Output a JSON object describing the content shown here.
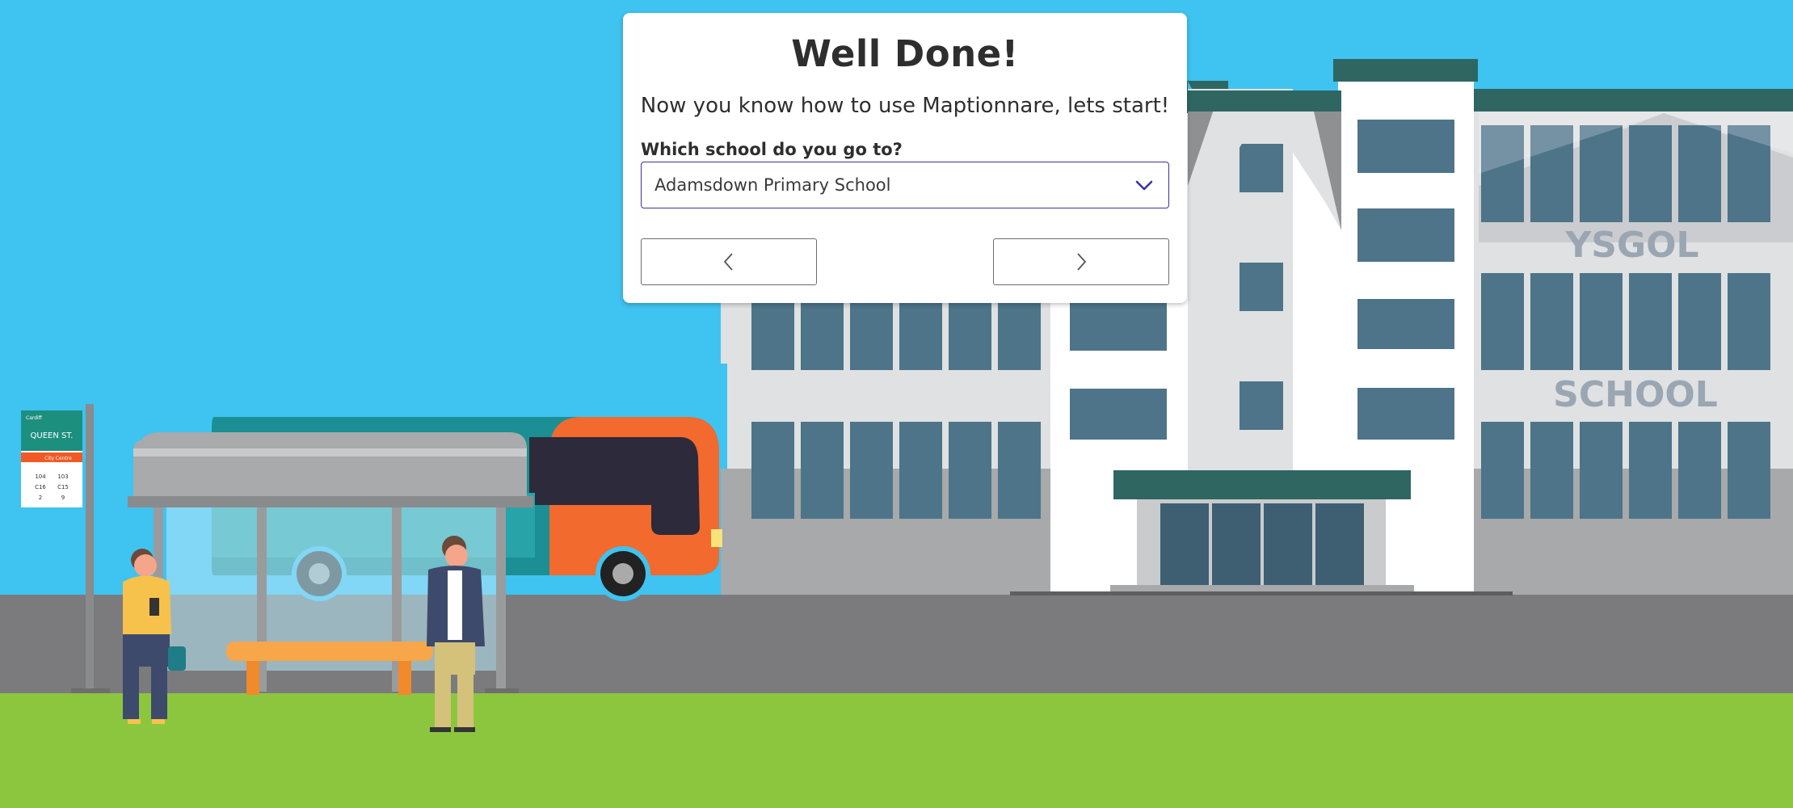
{
  "scene": {
    "sign_brand": "Cardiff",
    "sign_stop": "QUEEN ST.",
    "sign_route_label": "City Centre",
    "sign_rows": [
      [
        "104",
        "103"
      ],
      [
        "C16",
        "C15"
      ],
      [
        "2",
        "9"
      ]
    ],
    "building_word_1": "YSGOL",
    "building_word_2": "SCHOOL"
  },
  "dialog": {
    "title": "Well Done!",
    "subtitle": "Now you know how to use Maptionnare, lets start!",
    "question": "Which school do you go to?",
    "selected_school": "Adamsdown Primary School",
    "prev_icon": "chevron-left-icon",
    "next_icon": "chevron-right-icon",
    "dropdown_icon": "chevron-down-icon"
  },
  "colors": {
    "sky": "#3fc3f1",
    "grass": "#8cc63f",
    "road": "#7b7b7d",
    "accent": "#3b3496",
    "window": "#4d7489",
    "school_teal": "#2f6662"
  }
}
